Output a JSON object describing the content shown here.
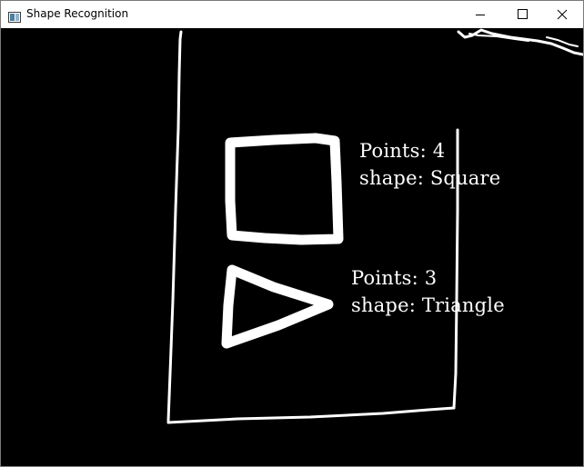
{
  "window": {
    "title": "Shape Recognition",
    "icon": "opencv-window-icon",
    "controls": [
      "minimize-icon",
      "maximize-icon",
      "close-icon"
    ]
  },
  "canvas": {
    "background": "#000000",
    "stroke_color": "#ffffff",
    "detections": [
      {
        "points_text": "Points: 4",
        "shape_text": "shape: Square"
      },
      {
        "points_text": "Points: 3",
        "shape_text": "shape: Triangle"
      }
    ]
  }
}
